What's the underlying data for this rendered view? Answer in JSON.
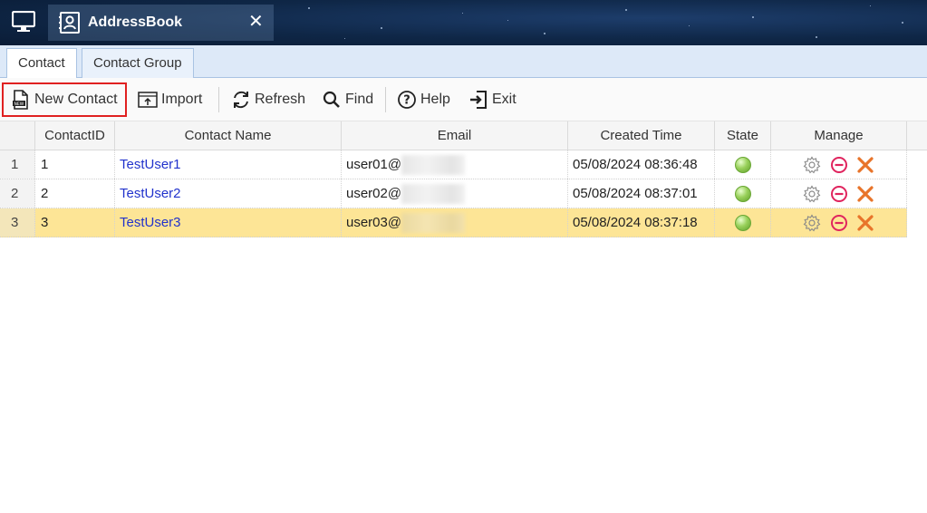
{
  "window": {
    "title": "AddressBook"
  },
  "tabs": [
    {
      "label": "Contact",
      "active": true
    },
    {
      "label": "Contact Group",
      "active": false
    }
  ],
  "toolbar": {
    "new_contact": "New Contact",
    "import": "Import",
    "refresh": "Refresh",
    "find": "Find",
    "help": "Help",
    "exit": "Exit"
  },
  "table": {
    "columns": [
      "ContactID",
      "Contact Name",
      "Email",
      "Created Time",
      "State",
      "Manage"
    ],
    "rows": [
      {
        "num": "1",
        "id": "1",
        "name": "TestUser1",
        "email": "user01@",
        "created": "05/08/2024 08:36:48",
        "state": "active"
      },
      {
        "num": "2",
        "id": "2",
        "name": "TestUser2",
        "email": "user02@",
        "created": "05/08/2024 08:37:01",
        "state": "active"
      },
      {
        "num": "3",
        "id": "3",
        "name": "TestUser3",
        "email": "user03@",
        "created": "05/08/2024 08:37:18",
        "state": "active",
        "selected": true
      }
    ]
  },
  "icons": {
    "settings": "gear-icon",
    "disable": "minus-circle-icon",
    "delete": "close-x-icon"
  },
  "colors": {
    "selected_row": "#fde596",
    "link": "#2233cc",
    "highlight_border": "#e02121",
    "state_active": "#7cc043"
  }
}
